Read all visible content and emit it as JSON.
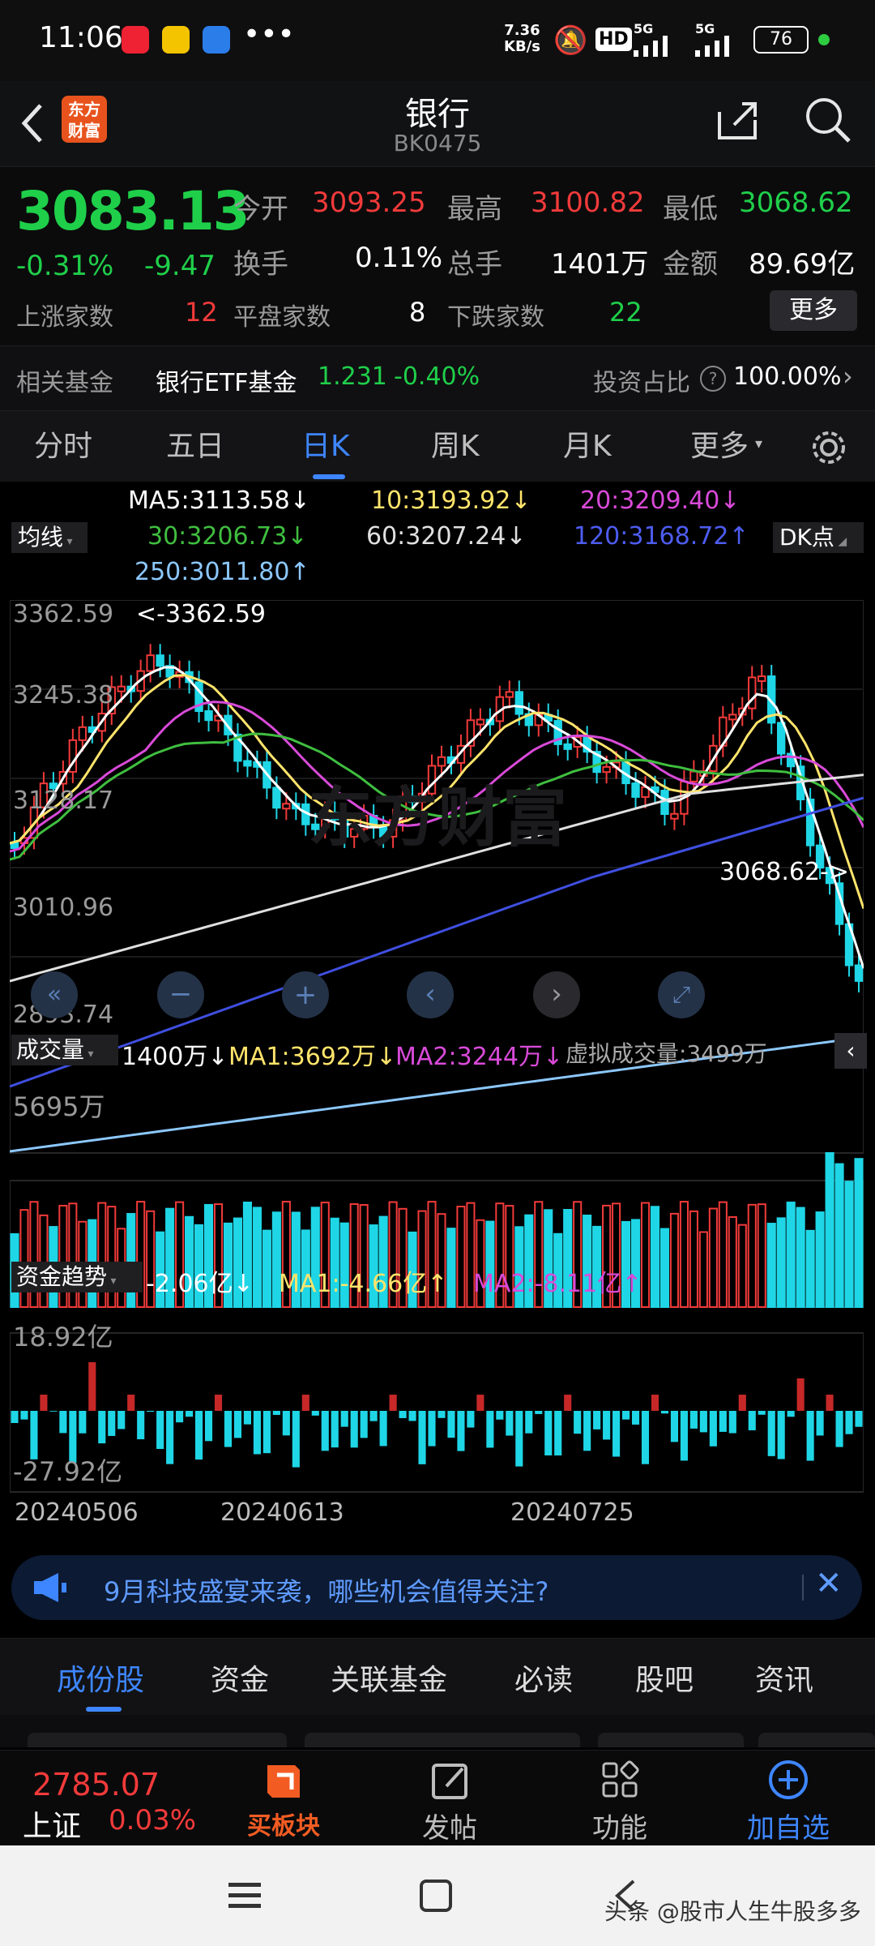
{
  "status": {
    "time": "11:06",
    "net_speed": "7.36",
    "net_unit": "KB/s",
    "battery": "76",
    "hd": "HD",
    "sig1": "5G",
    "sig2": "5G"
  },
  "header": {
    "title": "银行",
    "code": "BK0475",
    "logo_line1": "东方",
    "logo_line2": "财富"
  },
  "quote": {
    "price": "3083.13",
    "pct": "-0.31%",
    "chg": "-9.47",
    "open_label": "今开",
    "open": "3093.25",
    "high_label": "最高",
    "high": "3100.82",
    "low_label": "最低",
    "low": "3068.62",
    "turnover_label": "换手",
    "turnover": "0.11%",
    "volume_label": "总手",
    "volume": "1401万",
    "amount_label": "金额",
    "amount": "89.69亿",
    "up_label": "上涨家数",
    "up": "12",
    "flat_label": "平盘家数",
    "flat": "8",
    "down_label": "下跌家数",
    "down": "22",
    "more": "更多"
  },
  "fund": {
    "label": "相关基金",
    "name": "银行ETF基金",
    "price": "1.231",
    "pct": "-0.40%",
    "ratio_label": "投资占比",
    "ratio": "100.00%"
  },
  "tabs": [
    "分时",
    "五日",
    "日K",
    "周K",
    "月K",
    "更多"
  ],
  "ma": {
    "ma5": "MA5:3113.58↓",
    "ma10": "10:3193.92↓",
    "ma20": "20:3209.40↓",
    "ma30": "30:3206.73↓",
    "ma60": "60:3207.24↓",
    "ma120": "120:3168.72↑",
    "ma250": "250:3011.80↑",
    "indicator": "均线",
    "dk": "DK点"
  },
  "kline": {
    "y1": "3362.59",
    "y2": "3245.38",
    "y3": "3128.17",
    "y4": "3010.96",
    "y5": "2893.74",
    "high_marker": "<-3362.59",
    "low_marker": "3068.62->",
    "watermark": "东方财富"
  },
  "vol": {
    "label": "成交量",
    "value": "1400万↓",
    "ma1": "MA1:3692万↓",
    "ma2": "MA2:3244万↓",
    "virtual": "虚拟成交量:3499万",
    "ymax": "5695万"
  },
  "flow": {
    "label": "资金趋势",
    "value": "-2.06亿↓",
    "ma1": "MA1:-4.66亿↑",
    "ma2": "MA2:-8.11亿↑",
    "ymax": "18.92亿",
    "ymin": "-27.92亿"
  },
  "dates": [
    "20240506",
    "20240613",
    "20240725"
  ],
  "news": {
    "text": "9月科技盛宴来袭，哪些机会值得关注?"
  },
  "bottom_tabs": [
    "成份股",
    "资金",
    "关联基金",
    "必读",
    "股吧",
    "资讯"
  ],
  "nav": {
    "index_value": "2785.07",
    "index_name": "上证",
    "index_pct": "0.03%",
    "buy": "买板块",
    "post": "发帖",
    "func": "功能",
    "add": "加自选"
  },
  "watermark_credit": "头条 @股市人生牛股多多",
  "colors": {
    "up": "#f23a3a",
    "down": "#1fd6e6",
    "accent": "#3e86ff",
    "ma5": "#ffffff",
    "ma10": "#ffe46b",
    "ma20": "#d94ad9",
    "ma30": "#3fbe3f",
    "ma60": "#e0e0e0",
    "ma120": "#3f4fe0",
    "ma250": "#8cc8ff"
  }
}
